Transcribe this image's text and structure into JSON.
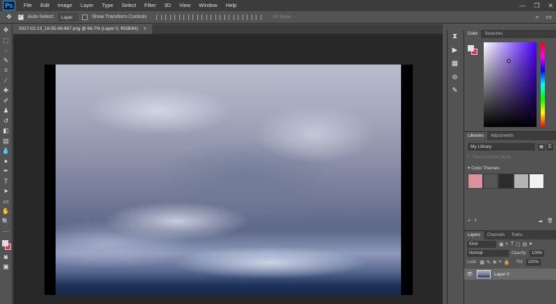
{
  "menubar": {
    "app_logo": "Ps",
    "items": [
      "File",
      "Edit",
      "Image",
      "Layer",
      "Type",
      "Select",
      "Filter",
      "3D",
      "View",
      "Window",
      "Help"
    ]
  },
  "options": {
    "auto_select_label": "Auto-Select:",
    "auto_select_value": "Layer",
    "show_transform_label": "Show Transform Controls",
    "mode_3d_label": "3D Mode:"
  },
  "document": {
    "tab_title": "2017-02-13_18-55-08-967.png @ 66.7% (Layer 0, RGB/8#)",
    "close_glyph": "×"
  },
  "color_panel": {
    "tabs": [
      "Color",
      "Swatches"
    ],
    "fg_color": "#e6e0f0",
    "bg_color": "#e8354f"
  },
  "libraries_panel": {
    "tabs": [
      "Libraries",
      "Adjustments"
    ],
    "library_name": "My Library",
    "search_placeholder": "Search Adobe Stock",
    "themes_title": "Color Themes",
    "theme_colors": [
      "#d8939a",
      "#555555",
      "#2d2d2d",
      "#b4b4b4",
      "#f1f1f1"
    ]
  },
  "layers_panel": {
    "tabs": [
      "Layers",
      "Channels",
      "Paths"
    ],
    "kind_label": "Kind",
    "blend_mode": "Normal",
    "opacity_label": "Opacity:",
    "opacity_value": "100%",
    "lock_label": "Lock:",
    "fill_label": "Fill:",
    "fill_value": "100%",
    "layers": [
      {
        "name": "Layer 0",
        "visible": true
      }
    ]
  }
}
